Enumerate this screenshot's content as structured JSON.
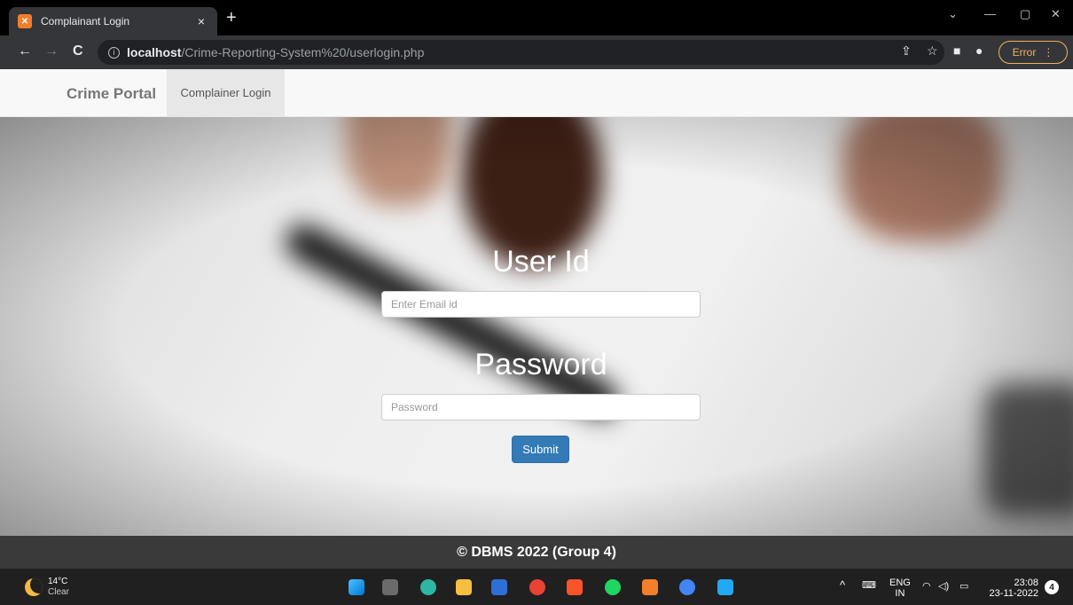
{
  "browser": {
    "tab_title": "Complainant Login",
    "tab_close": "×",
    "new_tab": "+",
    "url_host": "localhost",
    "url_path": "/Crime-Reporting-System%20/userlogin.php",
    "error_label": "Error"
  },
  "navbar": {
    "brand": "Crime Portal",
    "link": "Complainer Login"
  },
  "form": {
    "userid_label": "User Id",
    "email_placeholder": "Enter Email id",
    "password_label": "Password",
    "password_placeholder": "Password",
    "submit_label": "Submit"
  },
  "footer": {
    "text": "© DBMS 2022 (Group 4)"
  },
  "taskbar": {
    "temperature": "14°C",
    "condition": "Clear",
    "lang_top": "ENG",
    "lang_bottom": "IN",
    "time": "23:08",
    "date": "23-11-2022",
    "notifications": "4"
  },
  "colors": {
    "submit": "#337ab7",
    "footer": "#3a3a3a",
    "error": "#f2b15e"
  }
}
